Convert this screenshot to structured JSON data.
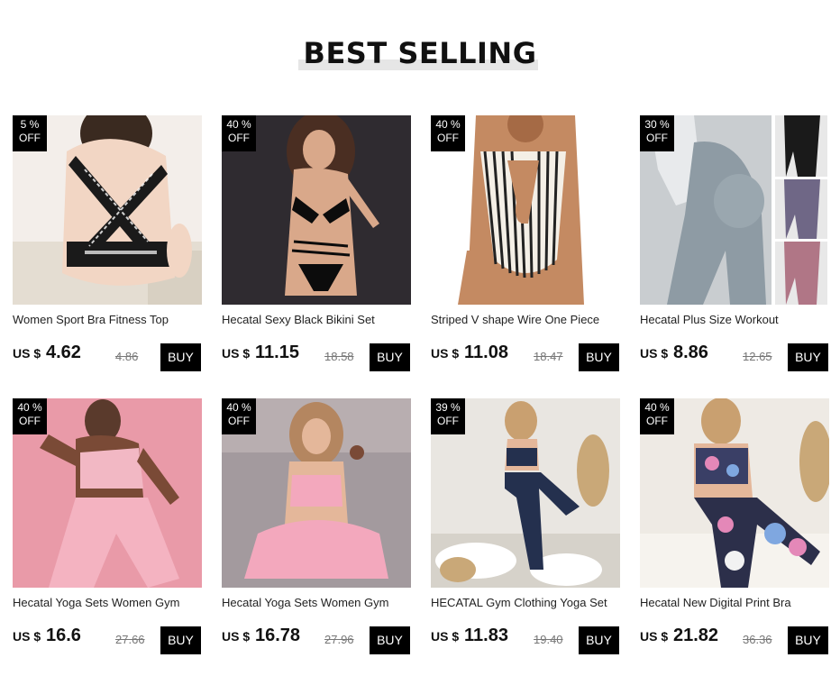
{
  "header": {
    "title": "BEST SELLING"
  },
  "currency": "US $",
  "buy_label": "BUY",
  "products": [
    {
      "discount": "5 %",
      "off": "OFF",
      "name": "Women Sport Bra Fitness Top",
      "price": "4.62",
      "old_price": "4.86"
    },
    {
      "discount": "40 %",
      "off": "OFF",
      "name": "Hecatal Sexy Black Bikini Set",
      "price": "11.15",
      "old_price": "18.58"
    },
    {
      "discount": "40 %",
      "off": "OFF",
      "name": "Striped V shape Wire One Piece",
      "price": "11.08",
      "old_price": "18.47"
    },
    {
      "discount": "30 %",
      "off": "OFF",
      "name": "Hecatal Plus Size Workout",
      "price": "8.86",
      "old_price": "12.65"
    },
    {
      "discount": "40 %",
      "off": "OFF",
      "name": "Hecatal Yoga Sets Women Gym",
      "price": "16.6",
      "old_price": "27.66"
    },
    {
      "discount": "40 %",
      "off": "OFF",
      "name": "Hecatal Yoga Sets Women Gym",
      "price": "16.78",
      "old_price": "27.96"
    },
    {
      "discount": "39 %",
      "off": "OFF",
      "name": "HECATAL Gym Clothing Yoga Set",
      "price": "11.83",
      "old_price": "19.40"
    },
    {
      "discount": "40 %",
      "off": "OFF",
      "name": "Hecatal New Digital Print Bra",
      "price": "21.82",
      "old_price": "36.36"
    }
  ]
}
